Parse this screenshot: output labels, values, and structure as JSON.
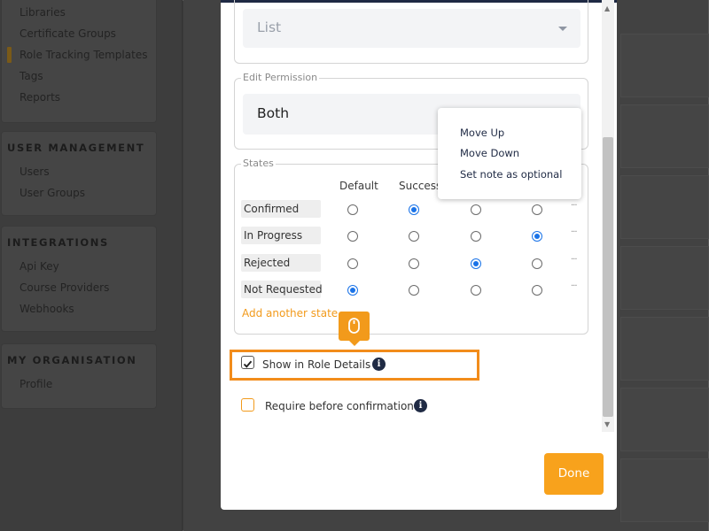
{
  "sidebar": {
    "content_items": [
      "Libraries",
      "Certificate Groups",
      "Role Tracking Templates",
      "Tags",
      "Reports"
    ],
    "user_management": {
      "heading": "USER MANAGEMENT",
      "items": [
        "Users",
        "User Groups"
      ]
    },
    "integrations": {
      "heading": "INTEGRATIONS",
      "items": [
        "Api Key",
        "Course Providers",
        "Webhooks"
      ]
    },
    "my_organisation": {
      "heading": "MY ORGANISATION",
      "items": [
        "Profile"
      ]
    }
  },
  "modal": {
    "type_select": {
      "value": "List"
    },
    "edit_permission": {
      "legend": "Edit Permission",
      "value": "Both"
    },
    "states": {
      "legend": "States",
      "columns": [
        "Default",
        "Success"
      ],
      "rows": [
        {
          "label": "Confirmed",
          "selected": 1
        },
        {
          "label": "In Progress",
          "selected": 3
        },
        {
          "label": "Rejected",
          "selected": 2
        },
        {
          "label": "Not Requested",
          "selected": 0
        }
      ],
      "row_action_glyph": "···",
      "add_link": "Add another state"
    },
    "context_menu": [
      "Move Up",
      "Move Down",
      "Set note as optional"
    ],
    "options": {
      "show_in_role_details": {
        "label": "Show in Role Details",
        "checked": true
      },
      "require_before_confirmation": {
        "label": "Require before confirmation",
        "checked": false
      }
    },
    "info_glyph": "i",
    "done_label": "Done"
  },
  "colors": {
    "accent": "#f29a1b",
    "navy": "#1f2a44",
    "radio_selected": "#1a73e8"
  }
}
